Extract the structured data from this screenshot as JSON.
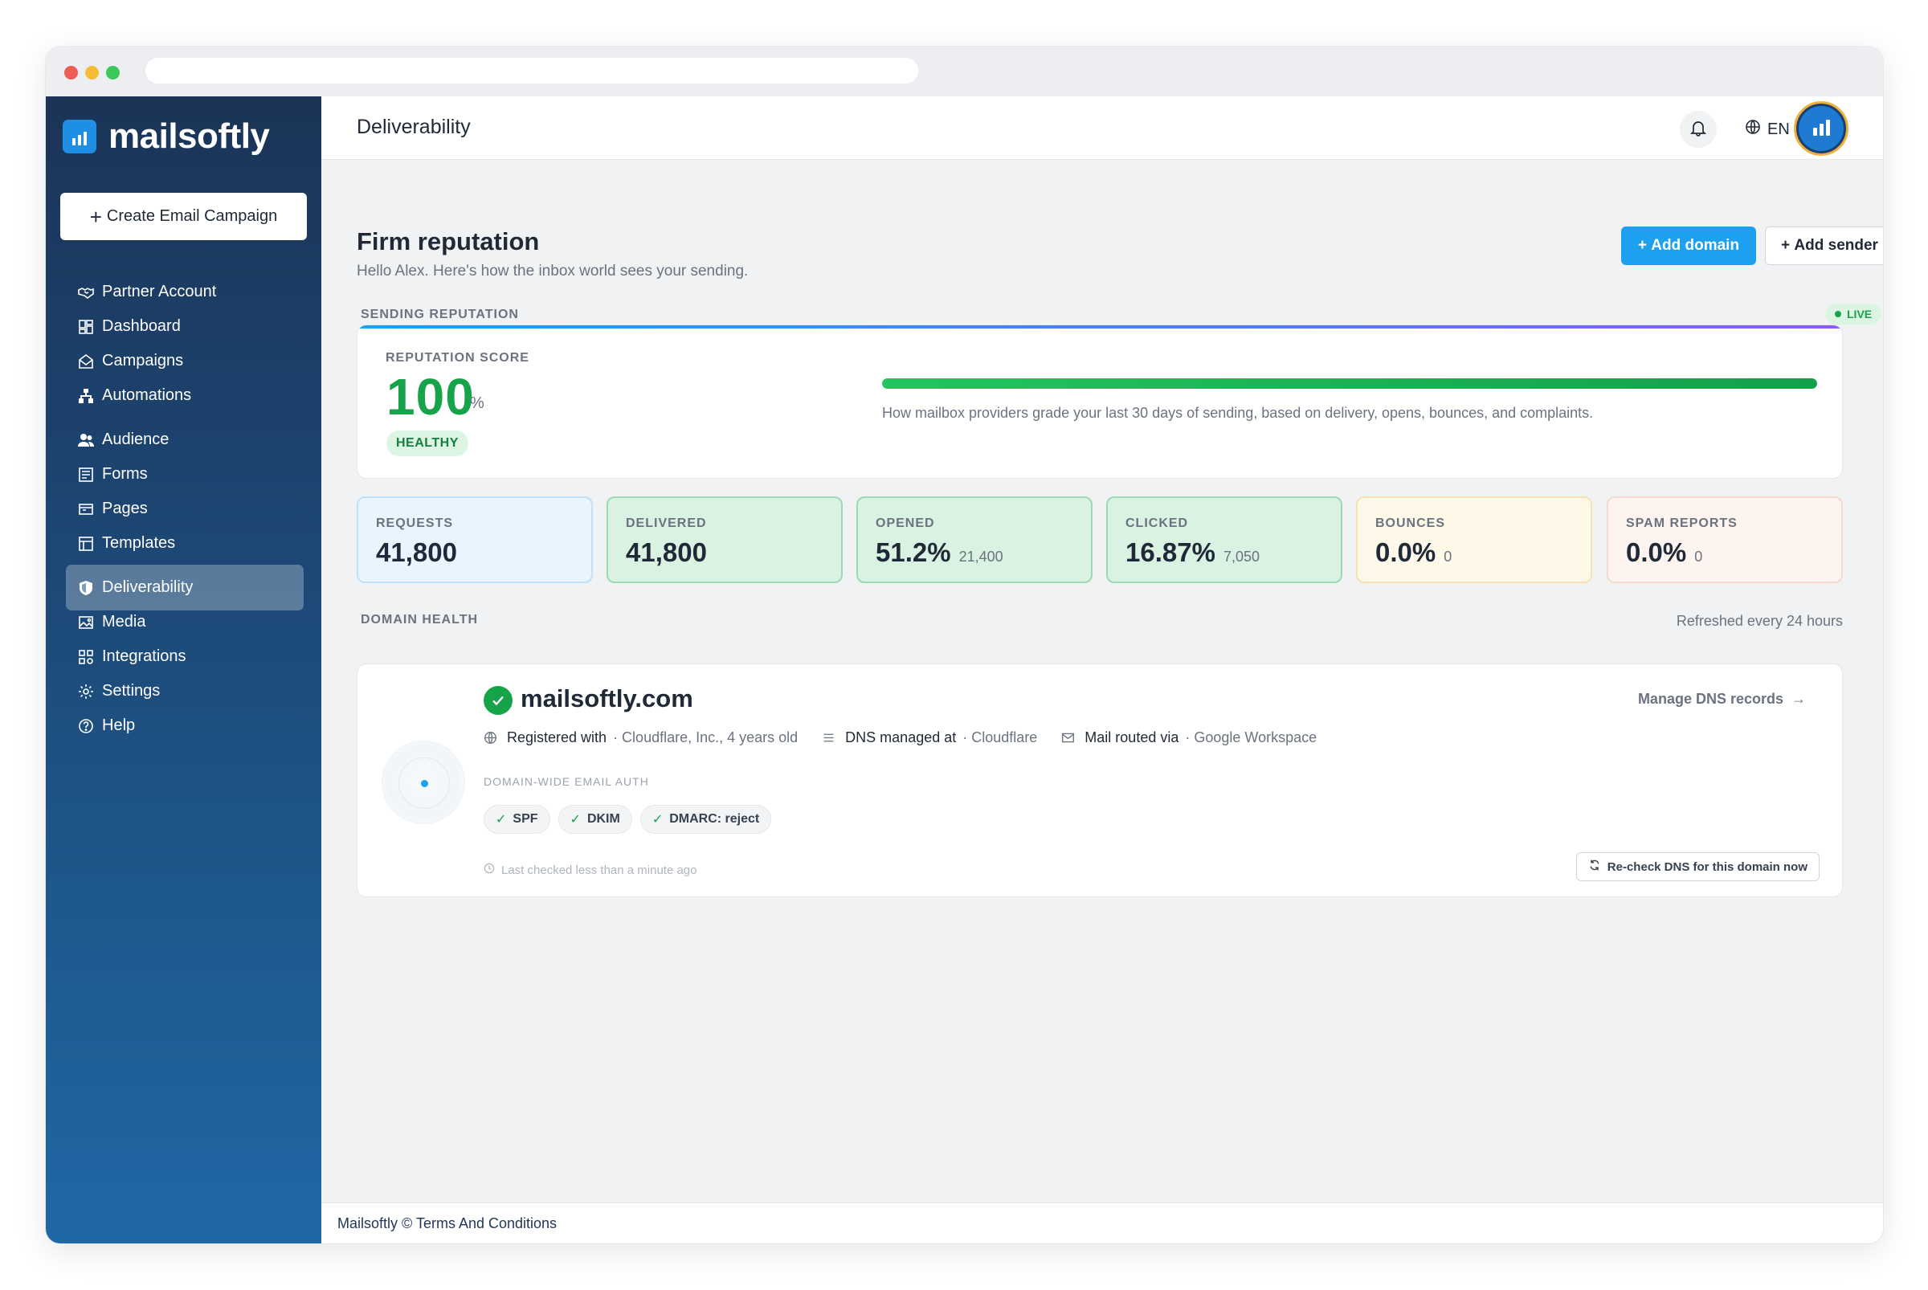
{
  "app": {
    "brand": "mailsoftly",
    "accent_color": "#1da0ef",
    "success_color": "#16a34a"
  },
  "sidebar": {
    "create_button": "Create Email Campaign",
    "items": [
      {
        "label": "Partner Account",
        "icon": "handshake-icon"
      },
      {
        "label": "Dashboard",
        "icon": "dashboard-icon"
      },
      {
        "label": "Campaigns",
        "icon": "campaigns-icon"
      },
      {
        "label": "Automations",
        "icon": "automations-icon"
      },
      {
        "label": "Audience",
        "icon": "audience-icon"
      },
      {
        "label": "Forms",
        "icon": "forms-icon"
      },
      {
        "label": "Pages",
        "icon": "pages-icon"
      },
      {
        "label": "Templates",
        "icon": "templates-icon"
      },
      {
        "label": "Deliverability",
        "icon": "shield-icon",
        "active": true
      },
      {
        "label": "Media",
        "icon": "media-icon"
      },
      {
        "label": "Integrations",
        "icon": "integrations-icon"
      },
      {
        "label": "Settings",
        "icon": "gear-icon"
      },
      {
        "label": "Help",
        "icon": "help-icon"
      }
    ]
  },
  "header": {
    "title": "Deliverability",
    "language": "EN"
  },
  "page": {
    "title": "Firm reputation",
    "subtitle": "Hello Alex. Here's how the inbox world sees your sending.",
    "add_domain": "Add domain",
    "add_sender": "Add sender"
  },
  "reputation": {
    "section_label": "SENDING REPUTATION",
    "live_label": "LIVE",
    "score_label": "REPUTATION SCORE",
    "score": "100",
    "score_unit": "%",
    "score_fraction": 1.0,
    "status": "HEALTHY",
    "description": "How mailbox providers grade your last 30 days of sending, based on delivery, opens, bounces, and complaints."
  },
  "stats": [
    {
      "label": "REQUESTS",
      "value": "41,800",
      "sub": ""
    },
    {
      "label": "DELIVERED",
      "value": "41,800",
      "sub": ""
    },
    {
      "label": "OPENED",
      "value": "51.2%",
      "sub": "21,400"
    },
    {
      "label": "CLICKED",
      "value": "16.87%",
      "sub": "7,050"
    },
    {
      "label": "BOUNCES",
      "value": "0.0%",
      "sub": "0"
    },
    {
      "label": "SPAM REPORTS",
      "value": "0.0%",
      "sub": "0"
    }
  ],
  "domain_health": {
    "section_label": "DOMAIN HEALTH",
    "refresh_note": "Refreshed every 24 hours",
    "domain": "mailsoftly.com",
    "manage_link": "Manage DNS records",
    "registered_label": "Registered with",
    "registered_value": "· Cloudflare, Inc., 4 years old",
    "dns_label": "DNS managed at",
    "dns_value": "· Cloudflare",
    "mail_label": "Mail routed via",
    "mail_value": "· Google Workspace",
    "auth_label": "DOMAIN-WIDE EMAIL AUTH",
    "auth_pills": [
      "SPF",
      "DKIM",
      "DMARC: reject"
    ],
    "last_checked": "Last checked less than a minute ago",
    "recheck_button": "Re-check DNS for this domain now"
  },
  "footer": {
    "text": "Mailsoftly © Terms And Conditions"
  }
}
